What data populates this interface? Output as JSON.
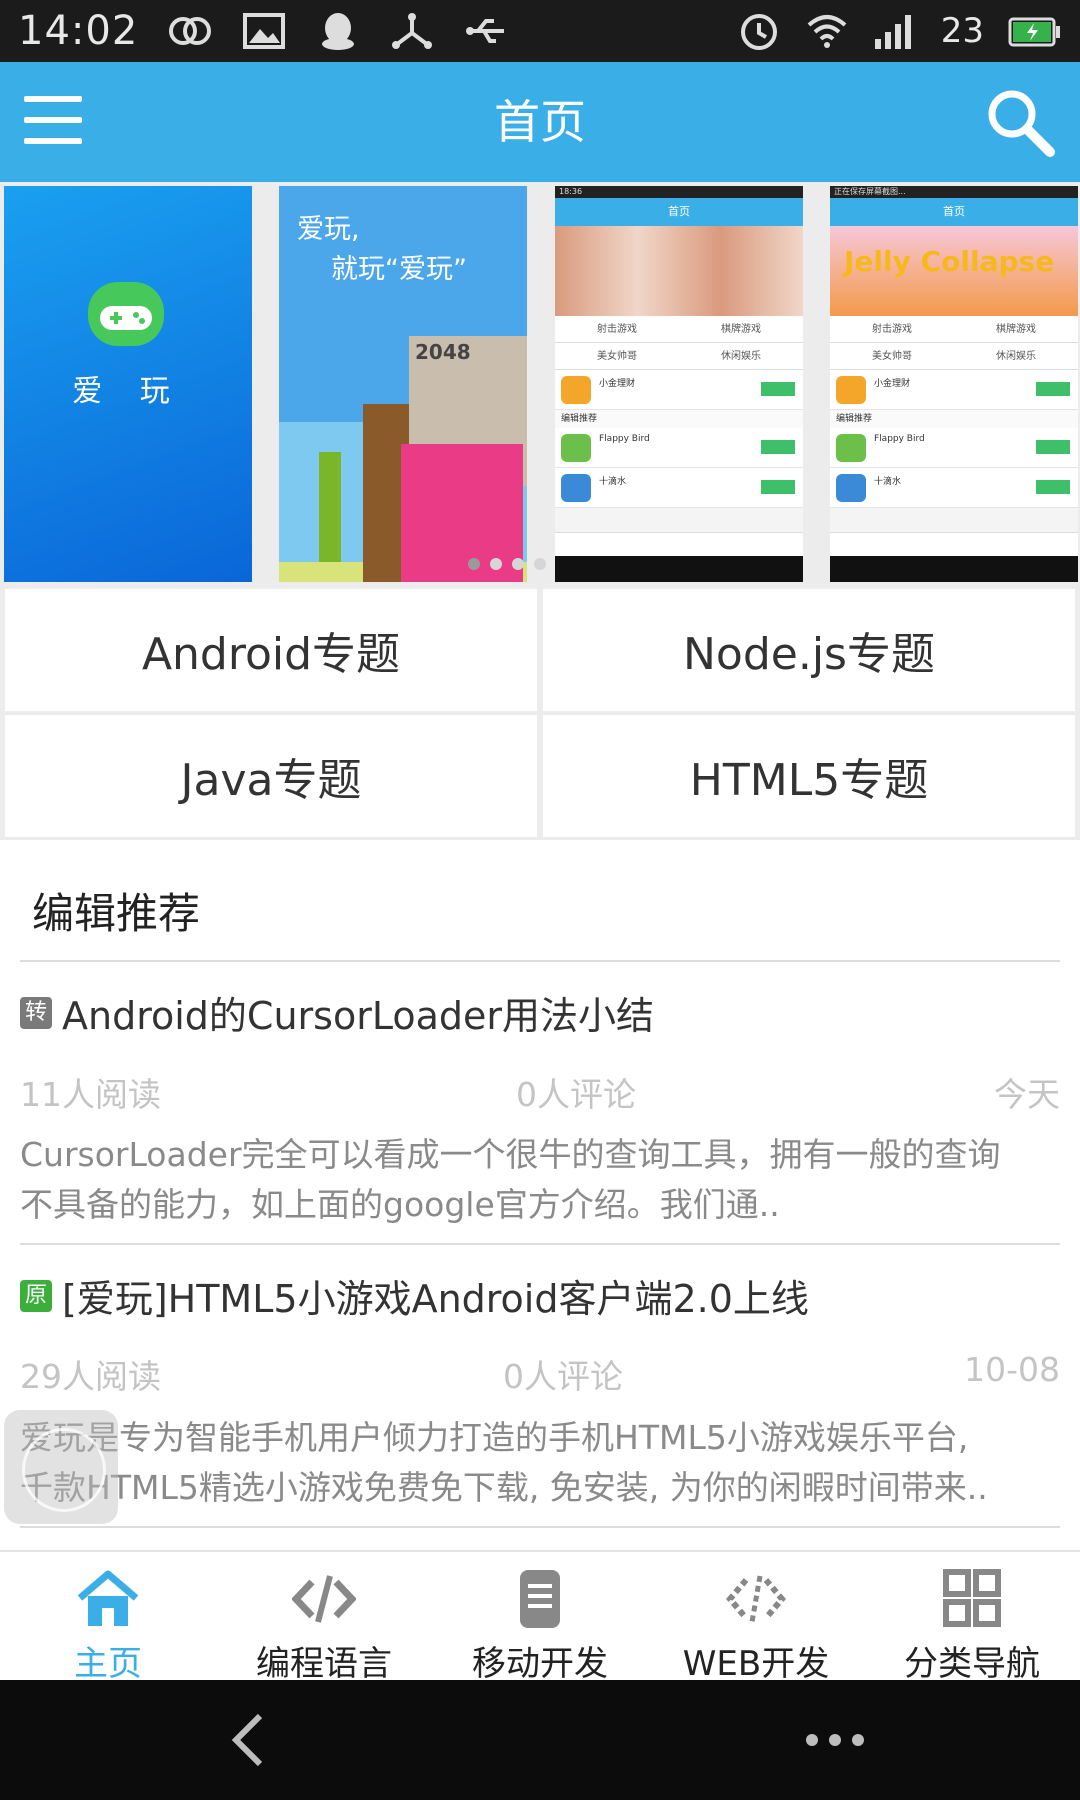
{
  "status_bar": {
    "time": "14:02",
    "battery": "23"
  },
  "header": {
    "title": "首页"
  },
  "banner": {
    "slide1_brand": "爱 玩",
    "slide2_slogan_line1": "爱玩,",
    "slide2_slogan_line2": "就玩“爱玩”",
    "slide2_game_label": "2048",
    "mini": {
      "slide3_status_time": "18:36",
      "slide4_status_text": "正在保存屏幕截图...",
      "title": "首页",
      "game_logo": "Jelly Collapse",
      "grid": [
        "射击游戏",
        "棋牌游戏",
        "美女帅哥",
        "休闲娱乐"
      ],
      "row_app": "小金理财",
      "section": "编辑推荐",
      "row2": "Flappy Bird",
      "row3": "十滴水"
    }
  },
  "topics": [
    {
      "label": "Android专题"
    },
    {
      "label": "Node.js专题"
    },
    {
      "label": "Java专题"
    },
    {
      "label": "HTML5专题"
    }
  ],
  "section_title": "编辑推荐",
  "articles": [
    {
      "tag": "转",
      "tag_color": "#7a7a7a",
      "title": "Android的CursorLoader用法小结",
      "reads": "11人阅读",
      "comments": "0人评论",
      "date": "今天",
      "desc_line1": "CursorLoader完全可以看成一个很牛的查询工具，拥有一般的查询",
      "desc_line2": "不具备的能力，如上面的google官方介绍。我们通.."
    },
    {
      "tag": "原",
      "tag_color": "#3cae3c",
      "title": "[爱玩]HTML5小游戏Android客户端2.0上线",
      "reads": "29人阅读",
      "comments": "0人评论",
      "date": "10-08",
      "desc_line1": "爱玩是专为智能手机用户倾力打造的手机HTML5小游戏娱乐平台,",
      "desc_line2": "千款HTML5精选小游戏免费免下载, 免安装, 为你的闲暇时间带来.."
    }
  ],
  "tabs": [
    {
      "label": "主页",
      "icon": "home-icon",
      "active": true
    },
    {
      "label": "编程语言",
      "icon": "code-icon",
      "active": false
    },
    {
      "label": "移动开发",
      "icon": "phone-icon",
      "active": false
    },
    {
      "label": "WEB开发",
      "icon": "web-code-icon",
      "active": false
    },
    {
      "label": "分类导航",
      "icon": "grid-icon",
      "active": false
    }
  ],
  "colors": {
    "accent": "#3aaee6",
    "status_bar": "#1b1b1b",
    "system_nav": "#0c0c0c"
  }
}
